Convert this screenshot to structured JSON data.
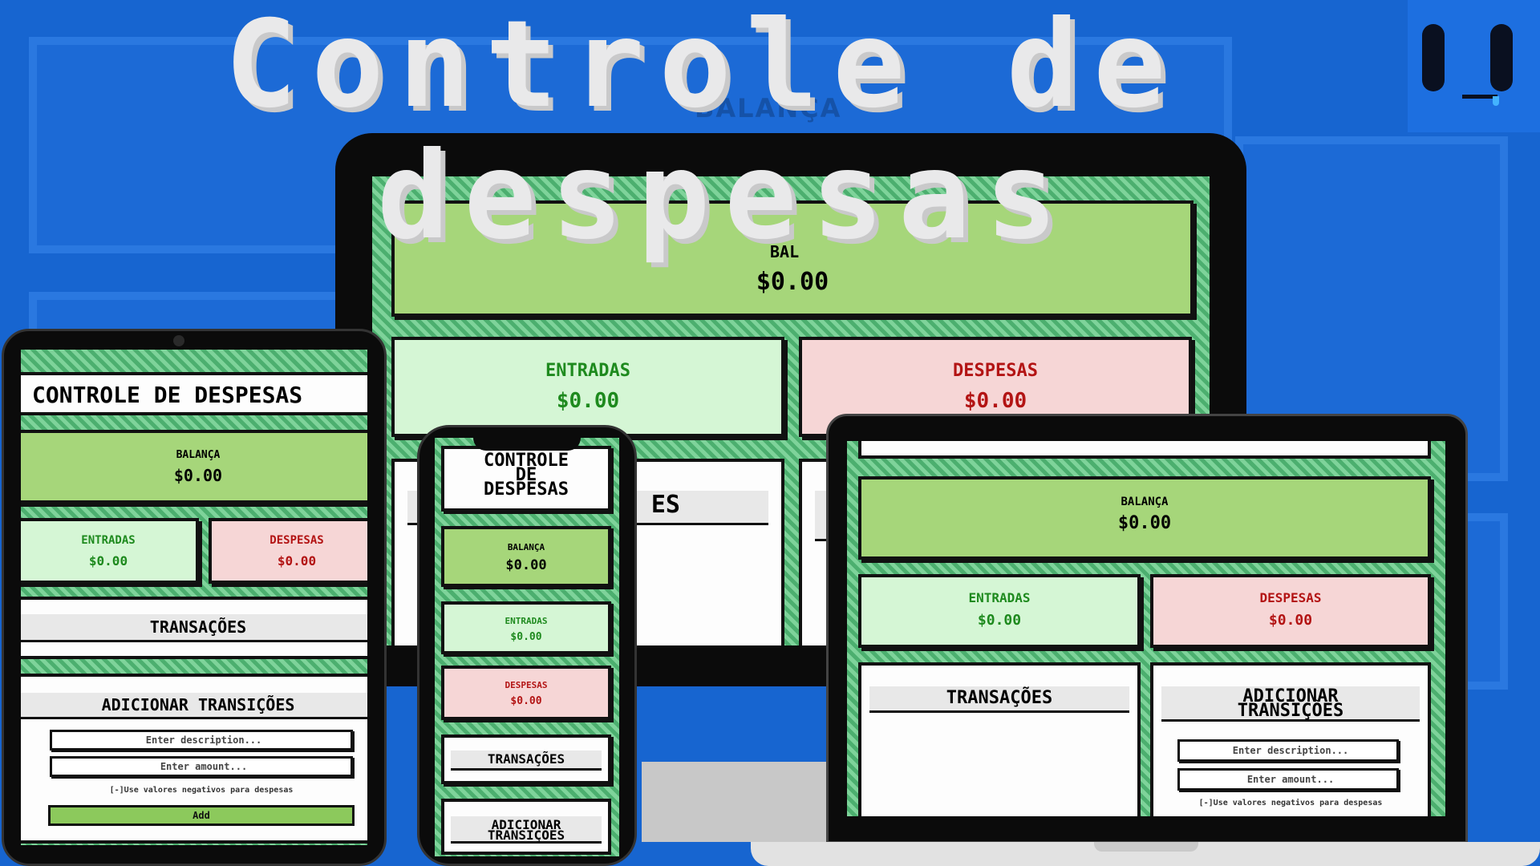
{
  "hero": {
    "line1": "Controle de",
    "line2": "despesas",
    "ghost": "BALANÇA"
  },
  "app": {
    "title": "CONTROLE DE DESPESAS",
    "title_words": [
      "CONTROLE",
      "DE",
      "DESPESAS"
    ],
    "balance_label": "BALANÇA",
    "balance_value": "$0.00",
    "balance_clipped": "BAL",
    "income_label": "ENTRADAS",
    "income_value": "$0.00",
    "expense_label": "DESPESAS",
    "expense_value": "$0.00",
    "transactions_header": "TRANSAÇÕES",
    "transactions_clipped": "ES",
    "add_header": "ADICIONAR TRANSIÇÕES",
    "add_header_words": [
      "ADICIONAR",
      "TRANSIÇÕES"
    ],
    "description_placeholder": "Enter description...",
    "amount_placeholder": "Enter amount...",
    "hint": "[-]Use valores negativos para despesas",
    "add_button": "Add"
  },
  "colors": {
    "background": "#1765d0",
    "balance": "#a6d67a",
    "income": "#d5f6d5",
    "expense": "#f6d6d6",
    "income_text": "#1e8a1e",
    "expense_text": "#b31414"
  }
}
